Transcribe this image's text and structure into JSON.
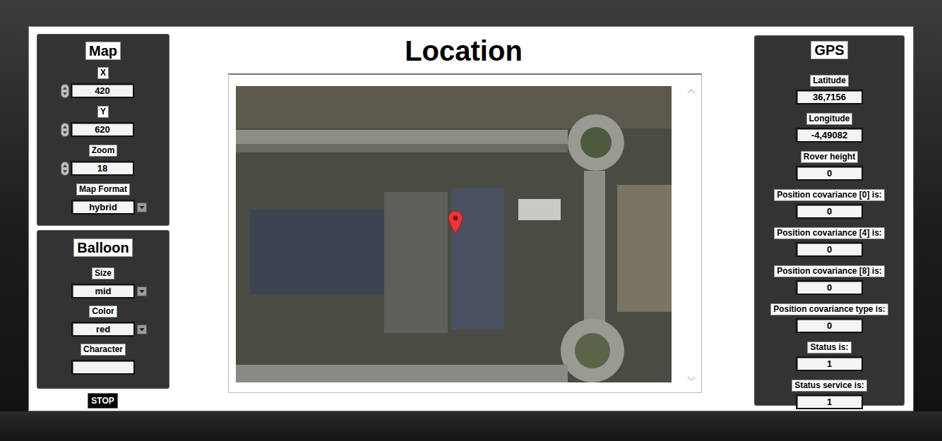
{
  "title": "Location",
  "map_panel": {
    "title": "Map",
    "fields": [
      {
        "label": "X",
        "value": "420"
      },
      {
        "label": "Y",
        "value": "620"
      },
      {
        "label": "Zoom",
        "value": "18"
      }
    ],
    "format": {
      "label": "Map Format",
      "value": "hybrid"
    }
  },
  "balloon_panel": {
    "title": "Balloon",
    "fields": [
      {
        "label": "Size",
        "value": "mid"
      },
      {
        "label": "Color",
        "value": "red"
      }
    ],
    "character": {
      "label": "Character",
      "value": ""
    }
  },
  "stop_button": "STOP",
  "gps_panel": {
    "title": "GPS",
    "fields": [
      {
        "label": "Latitude",
        "value": "36,7156"
      },
      {
        "label": "Longitude",
        "value": "-4,49082"
      },
      {
        "label": "Rover height",
        "value": "0"
      },
      {
        "label": "Position covariance [0] is:",
        "value": "0"
      },
      {
        "label": "Position covariance [4] is:",
        "value": "0"
      },
      {
        "label": "Position covariance [8] is:",
        "value": "0"
      },
      {
        "label": "Position covariance type is:",
        "value": "0"
      },
      {
        "label": "Status is:",
        "value": "1"
      },
      {
        "label": "Status service is:",
        "value": "1"
      }
    ]
  }
}
